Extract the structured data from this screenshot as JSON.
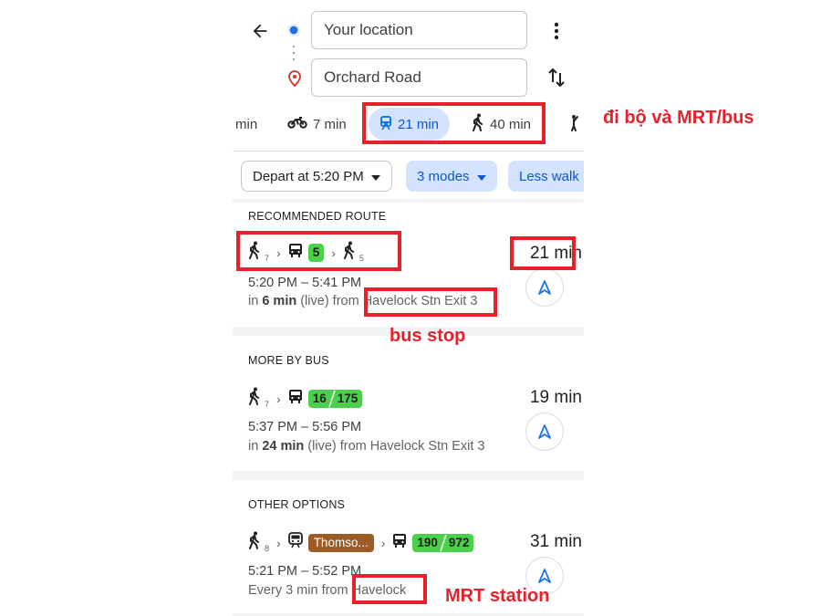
{
  "search": {
    "origin": "Your location",
    "destination": "Orchard Road"
  },
  "modes": [
    {
      "label": "min"
    },
    {
      "label": "7 min",
      "icon": "motorbike-icon"
    },
    {
      "label": "21 min",
      "icon": "train-icon",
      "selected": true
    },
    {
      "label": "40 min",
      "icon": "walk-icon"
    }
  ],
  "filters": {
    "depart": "Depart at 5:20 PM",
    "modes": "3 modes",
    "less_walk": "Less walk"
  },
  "recommended": {
    "heading": "RECOMMENDED ROUTE",
    "walk1": "7",
    "bus": "5",
    "walk2": "5",
    "duration": "21 min",
    "times": "5:20 PM – 5:41 PM",
    "live_prefix": "in ",
    "live_min": "6 min",
    "live_suffix": " (live) from ",
    "stop": "Havelock Stn Exit 3"
  },
  "more_bus": {
    "heading": "MORE BY BUS",
    "walk1": "7",
    "bus_a": "16",
    "bus_b": "175",
    "duration": "19 min",
    "times": "5:37 PM – 5:56 PM",
    "live_prefix": "in ",
    "live_min": "24 min",
    "live_suffix": " (live) from Havelock Stn Exit 3"
  },
  "other": {
    "heading": "OTHER OPTIONS",
    "walk1": "8",
    "train": "Thomso...",
    "bus_a": "190",
    "bus_b": "972",
    "duration": "31 min",
    "times": "5:21 PM – 5:52 PM",
    "freq": "Every 3 min from ",
    "station": "Havelock"
  },
  "annotations": {
    "modes_note": "đi bộ và MRT/bus",
    "bus_stop": "bus stop",
    "mrt_station": "MRT station"
  },
  "colors": {
    "accent_blue": "#1a73e8",
    "selected_chip": "#d3e3fd",
    "line_green": "#4ad04a",
    "mrt_brown": "#9d5b25",
    "annotation_red": "#e8202a"
  }
}
